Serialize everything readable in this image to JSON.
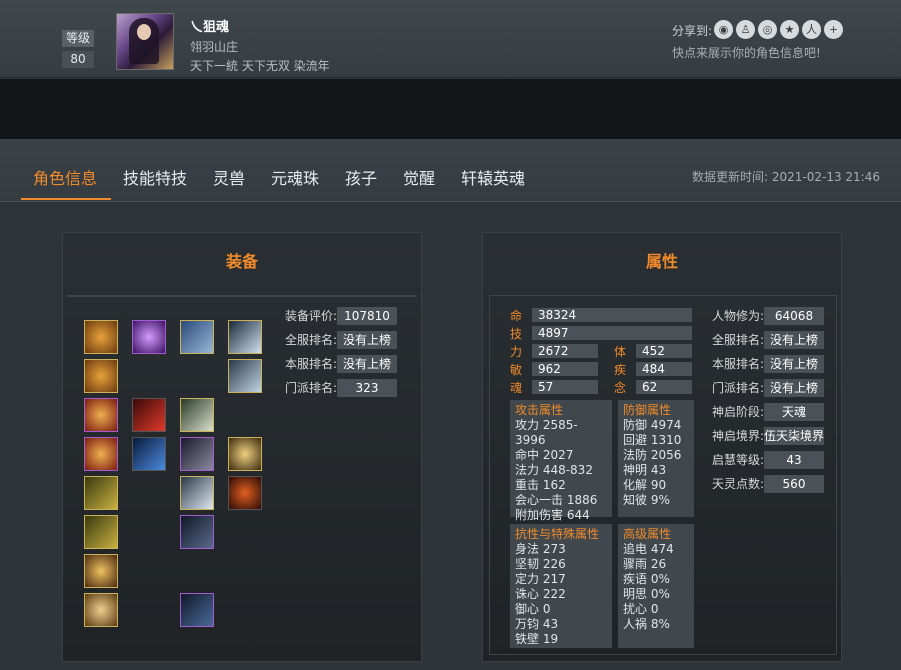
{
  "header": {
    "level_label": "等级",
    "level_value": "80",
    "player_name": "乀狙魂",
    "guild": "翎羽山庄",
    "title": "天下一統 天下无双 染流年",
    "share_label": "分享到:",
    "share_icons": [
      "wechat-icon",
      "qq-icon",
      "weibo-icon",
      "qzone-icon",
      "renren-icon",
      "more-icon"
    ],
    "share_hint": "快点来展示你的角色信息吧!"
  },
  "tabs": [
    "角色信息",
    "技能特技",
    "灵兽",
    "元魂珠",
    "孩子",
    "觉醒",
    "轩辕英魂"
  ],
  "update": "数据更新时间:  2021-02-13 21:46",
  "equip": {
    "title": "装备",
    "rows": [
      {
        "label": "装备评价:",
        "value": "107810"
      },
      {
        "label": "全服排名:",
        "value": "没有上榜"
      },
      {
        "label": "本服排名:",
        "value": "没有上榜"
      },
      {
        "label": "门派排名:",
        "value": "323"
      }
    ]
  },
  "attr": {
    "title": "属性",
    "bars": {
      "ming_label": "命",
      "ming": "38324",
      "ji_label": "技",
      "ji": "4897",
      "li_label": "力",
      "li": "2672",
      "ti_label": "体",
      "ti": "452",
      "min_label": "敏",
      "min": "962",
      "ji2_label": "疾",
      "ji2": "484",
      "hun_label": "魂",
      "hun": "57",
      "nian_label": "念",
      "nian": "62"
    },
    "attack": {
      "head": "攻击属性",
      "lines": [
        "攻力 2585-3996",
        "命中 2027",
        "法力 448-832",
        "重击 162",
        "会心一击 1886",
        "附加伤害 644"
      ]
    },
    "defense": {
      "head": "防御属性",
      "lines": [
        "防御 4974",
        "回避 1310",
        "法防 2056",
        "神明 43",
        "化解 90",
        "知彼 9%"
      ]
    },
    "resist": {
      "head": "抗性与特殊属性",
      "lines": [
        "身法 273",
        "坚韧 226",
        "定力 217",
        "诛心 222",
        "御心 0",
        "万钧 43",
        "铁壁 19"
      ]
    },
    "advanced": {
      "head": "高级属性",
      "lines": [
        "追电 474",
        "骤雨 26",
        "疾语 0%",
        "明思 0%",
        "扰心 0",
        "人祸 8%"
      ]
    },
    "right": [
      {
        "label": "人物修为:",
        "value": "64068"
      },
      {
        "label": "全服排名:",
        "value": "没有上榜"
      },
      {
        "label": "本服排名:",
        "value": "没有上榜"
      },
      {
        "label": "门派排名:",
        "value": "没有上榜"
      },
      {
        "label": "神启阶段:",
        "value": "天魂"
      },
      {
        "label": "神启境界:",
        "value": "伍天柒境界"
      },
      {
        "label": "启慧等级:",
        "value": "43"
      },
      {
        "label": "天灵点数:",
        "value": "560"
      }
    ]
  },
  "colors": {
    "accent": "#f08a2a",
    "panel": "#1f2326",
    "value_bg": "#4b5257"
  }
}
